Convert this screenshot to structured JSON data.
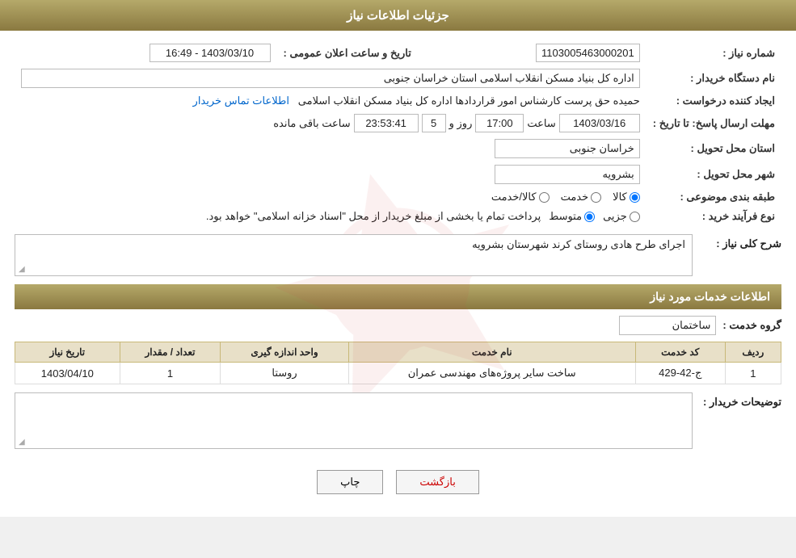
{
  "header": {
    "title": "جزئیات اطلاعات نیاز"
  },
  "fields": {
    "shomara_niaz_label": "شماره نیاز :",
    "shomara_niaz_value": "1103005463000201",
    "nam_dastgah_label": "نام دستگاه خریدار :",
    "nam_dastgah_value": "اداره کل بنیاد مسکن انقلاب اسلامی استان خراسان جنوبی",
    "ijad_konande_label": "ایجاد کننده درخواست :",
    "ijad_konande_value": "حمیده حق پرست کارشناس امور قراردادها اداره کل بنیاد مسکن انقلاب اسلامی",
    "ijad_konande_link": "اطلاعات تماس خریدار",
    "mohlat_label": "مهلت ارسال پاسخ: تا تاریخ :",
    "mohlat_date": "1403/03/16",
    "mohlat_time_label": "ساعت",
    "mohlat_time": "17:00",
    "mohlat_rooz_label": "روز و",
    "mohlat_rooz_value": "5",
    "mohlat_baqi_label": "ساعت باقی مانده",
    "mohlat_baqi_value": "23:53:41",
    "ostan_label": "استان محل تحویل :",
    "ostan_value": "خراسان جنوبی",
    "shahr_label": "شهر محل تحویل :",
    "shahr_value": "بشرویه",
    "tabaqe_label": "طبقه بندی موضوعی :",
    "tabaqe_options": [
      "کالا",
      "خدمت",
      "کالا/خدمت"
    ],
    "tabaqe_selected": "کالا",
    "tarikh_elan_label": "تاریخ و ساعت اعلان عمومی :",
    "tarikh_elan_value": "1403/03/10 - 16:49",
    "nooe_farayand_label": "نوع فرآیند خرید :",
    "nooe_farayand_options": [
      "جزیی",
      "متوسط"
    ],
    "nooe_farayand_selected": "متوسط",
    "nooe_farayand_text": "پرداخت تمام یا بخشی از مبلغ خریدار از محل \"اسناد خزانه اسلامی\" خواهد بود.",
    "sharh_label": "شرح کلی نیاز :",
    "sharh_value": "اجرای طرح هادی روستای کرند شهرستان بشرویه",
    "khadamat_label": "اطلاعات خدمات مورد نیاز",
    "grohe_khadamat_label": "گروه خدمت :",
    "grohe_khadamat_value": "ساختمان",
    "table_headers": [
      "ردیف",
      "کد خدمت",
      "نام خدمت",
      "واحد اندازه گیری",
      "تعداد / مقدار",
      "تاریخ نیاز"
    ],
    "table_rows": [
      {
        "radif": "1",
        "kod": "ج-42-429",
        "nam": "ساخت سایر پروژه‌های مهندسی عمران",
        "vahed": "روستا",
        "tedad": "1",
        "tarikh": "1403/04/10"
      }
    ],
    "toseeh_label": "توضیحات خریدار :",
    "toseeh_value": "",
    "btn_chap": "چاپ",
    "btn_bazgasht": "بازگشت"
  }
}
